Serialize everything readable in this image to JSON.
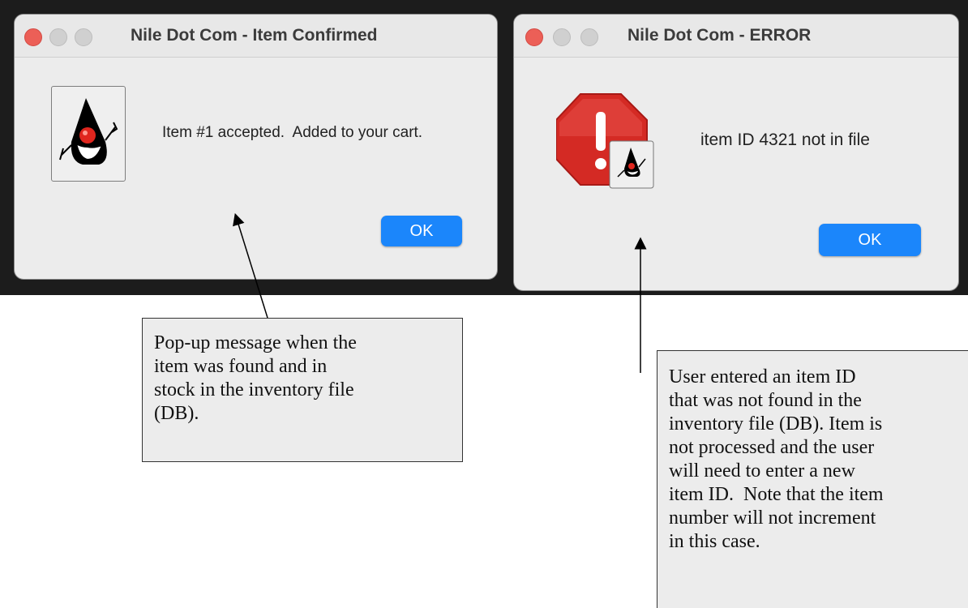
{
  "dialogs": [
    {
      "title": "Nile Dot Com - Item Confirmed",
      "message": "Item #1 accepted.  Added to your cart.",
      "ok_label": "OK",
      "icon": "java-duke-icon"
    },
    {
      "title": "Nile Dot Com - ERROR",
      "message": "item ID 4321 not in file",
      "ok_label": "OK",
      "icon": "error-stop-icon"
    }
  ],
  "callouts": [
    {
      "text": "Pop-up message when the\nitem was found and in\nstock in the inventory file\n(DB)."
    },
    {
      "text": "User entered an item ID\nthat was not found in the\ninventory file (DB). Item is\nnot processed and the user\nwill need to enter a new\nitem ID.  Note that the item\nnumber will not increment\nin this case."
    }
  ],
  "colors": {
    "ok_button": "#1b86fb",
    "close_dot": "#ec5f57",
    "stop_sign": "#d42a24"
  }
}
